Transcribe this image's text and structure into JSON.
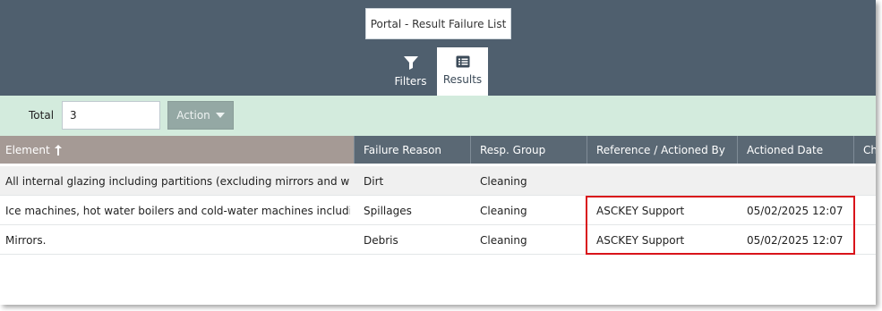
{
  "header": {
    "title": "Portal - Result Failure List",
    "tabs": [
      {
        "label": "Filters",
        "icon": "filter-icon",
        "active": false
      },
      {
        "label": "Results",
        "icon": "list-icon",
        "active": true
      }
    ]
  },
  "toolbar": {
    "total_label": "Total",
    "total_value": "3",
    "action_label": "Action"
  },
  "table": {
    "columns": [
      {
        "label": "Element",
        "sort": "ascending"
      },
      {
        "label": "Failure Reason"
      },
      {
        "label": "Resp. Group"
      },
      {
        "label": "Reference / Actioned By"
      },
      {
        "label": "Actioned Date"
      },
      {
        "label": "Ch"
      }
    ],
    "sort_icon": "sort-up-arrow-icon",
    "rows": [
      [
        "All internal glazing including partitions (excluding mirrors and wi...",
        "Dirt",
        "Cleaning",
        "",
        "",
        ""
      ],
      [
        "Ice machines, hot water boilers and cold-water machines includi...",
        "Spillages",
        "Cleaning",
        "ASCKEY Support",
        "05/02/2025 12:07",
        ""
      ],
      [
        "Mirrors.",
        "Debris",
        "Cleaning",
        "ASCKEY Support",
        "05/02/2025 12:07",
        ""
      ]
    ]
  },
  "colors": {
    "topbar": "#4f5f6e",
    "toolbar": "#d3ebdd",
    "header": "#5a6874",
    "sorted_header": "#a59a95",
    "highlight": "#d9141a"
  }
}
